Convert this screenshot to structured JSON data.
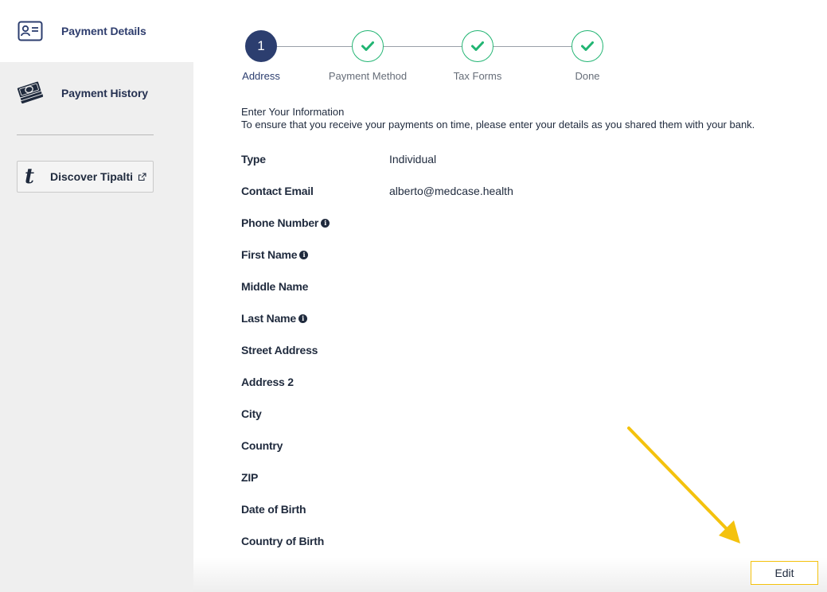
{
  "sidebar": {
    "items": [
      {
        "label": "Payment Details",
        "icon": "id-card-icon",
        "active": true
      },
      {
        "label": "Payment History",
        "icon": "money-stack-icon",
        "active": false
      }
    ],
    "discover": {
      "label": "Discover Tipalti",
      "logo": "t",
      "icon": "external-link-icon"
    }
  },
  "stepper": {
    "steps": [
      {
        "number": "1",
        "label": "Address",
        "state": "current"
      },
      {
        "label": "Payment Method",
        "state": "done"
      },
      {
        "label": "Tax Forms",
        "state": "done"
      },
      {
        "label": "Done",
        "state": "done"
      }
    ]
  },
  "intro": {
    "heading": "Enter Your Information",
    "description": "To ensure that you receive your payments on time, please enter your details as you shared them with your bank."
  },
  "fields": [
    {
      "label": "Type",
      "value": "Individual",
      "info": false
    },
    {
      "label": "Contact Email",
      "value": "alberto@medcase.health",
      "info": false
    },
    {
      "label": "Phone Number",
      "value": "",
      "info": true
    },
    {
      "label": "First Name",
      "value": "",
      "info": true
    },
    {
      "label": "Middle Name",
      "value": "",
      "info": false
    },
    {
      "label": "Last Name",
      "value": "",
      "info": true
    },
    {
      "label": "Street Address",
      "value": "",
      "info": false
    },
    {
      "label": "Address 2",
      "value": "",
      "info": false
    },
    {
      "label": "City",
      "value": "",
      "info": false
    },
    {
      "label": "Country",
      "value": "",
      "info": false
    },
    {
      "label": "ZIP",
      "value": "",
      "info": false
    },
    {
      "label": "Date of Birth",
      "value": "",
      "info": false
    },
    {
      "label": "Country of Birth",
      "value": "",
      "info": false
    }
  ],
  "actions": {
    "edit_label": "Edit"
  },
  "colors": {
    "accent_navy": "#2c3e6f",
    "success_green": "#22b573",
    "annotation_yellow": "#f4c20d",
    "sidebar_bg": "#efefef"
  }
}
